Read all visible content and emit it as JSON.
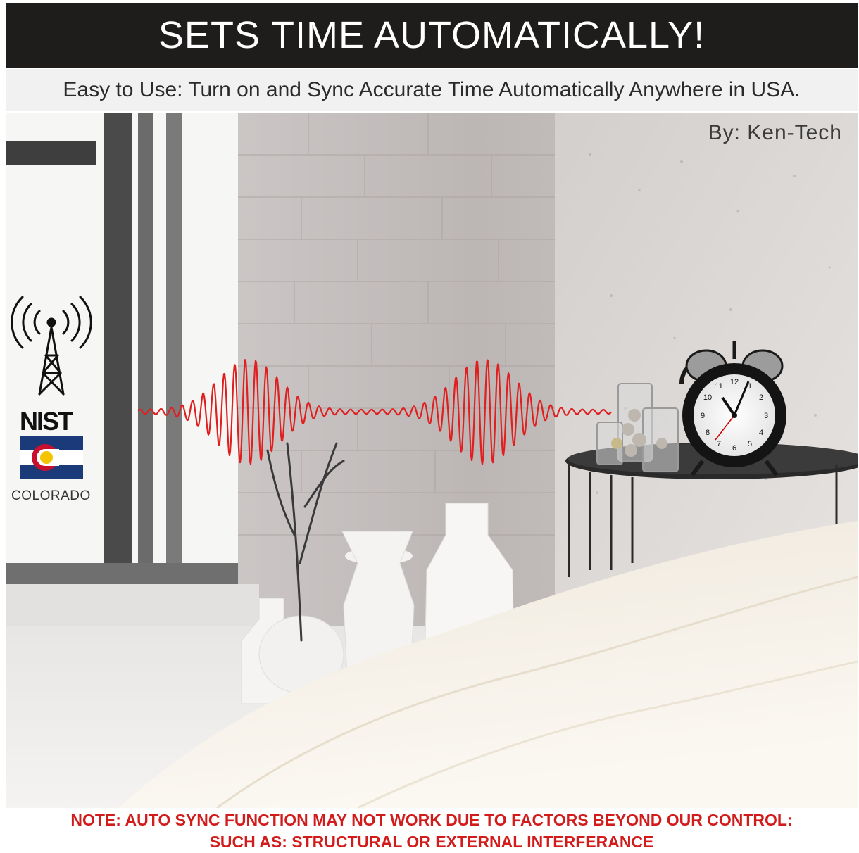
{
  "banner": {
    "title": "SETS TIME AUTOMATICALLY!",
    "subtitle": "Easy to Use: Turn on and Sync Accurate Time Automatically Anywhere in USA."
  },
  "byline": "By: Ken-Tech",
  "signal_source": {
    "agency": "NIST",
    "state": "COLORADO",
    "icon": "radio-tower-icon"
  },
  "clock_face": {
    "numerals": [
      "12",
      "1",
      "2",
      "3",
      "4",
      "5",
      "6",
      "7",
      "8",
      "9",
      "10",
      "11"
    ]
  },
  "note": {
    "line1": "NOTE: AUTO SYNC FUNCTION MAY NOT WORK DUE TO FACTORS BEYOND OUR CONTROL:",
    "line2": "SUCH AS: STRUCTURAL OR EXTERNAL INTERFERANCE"
  },
  "colors": {
    "banner_bg": "#1f1c1c",
    "wave": "#e02020",
    "note_text": "#d21b1b",
    "flag_blue": "#1b3a7a",
    "flag_red": "#c8102e",
    "flag_gold": "#f5c400"
  }
}
